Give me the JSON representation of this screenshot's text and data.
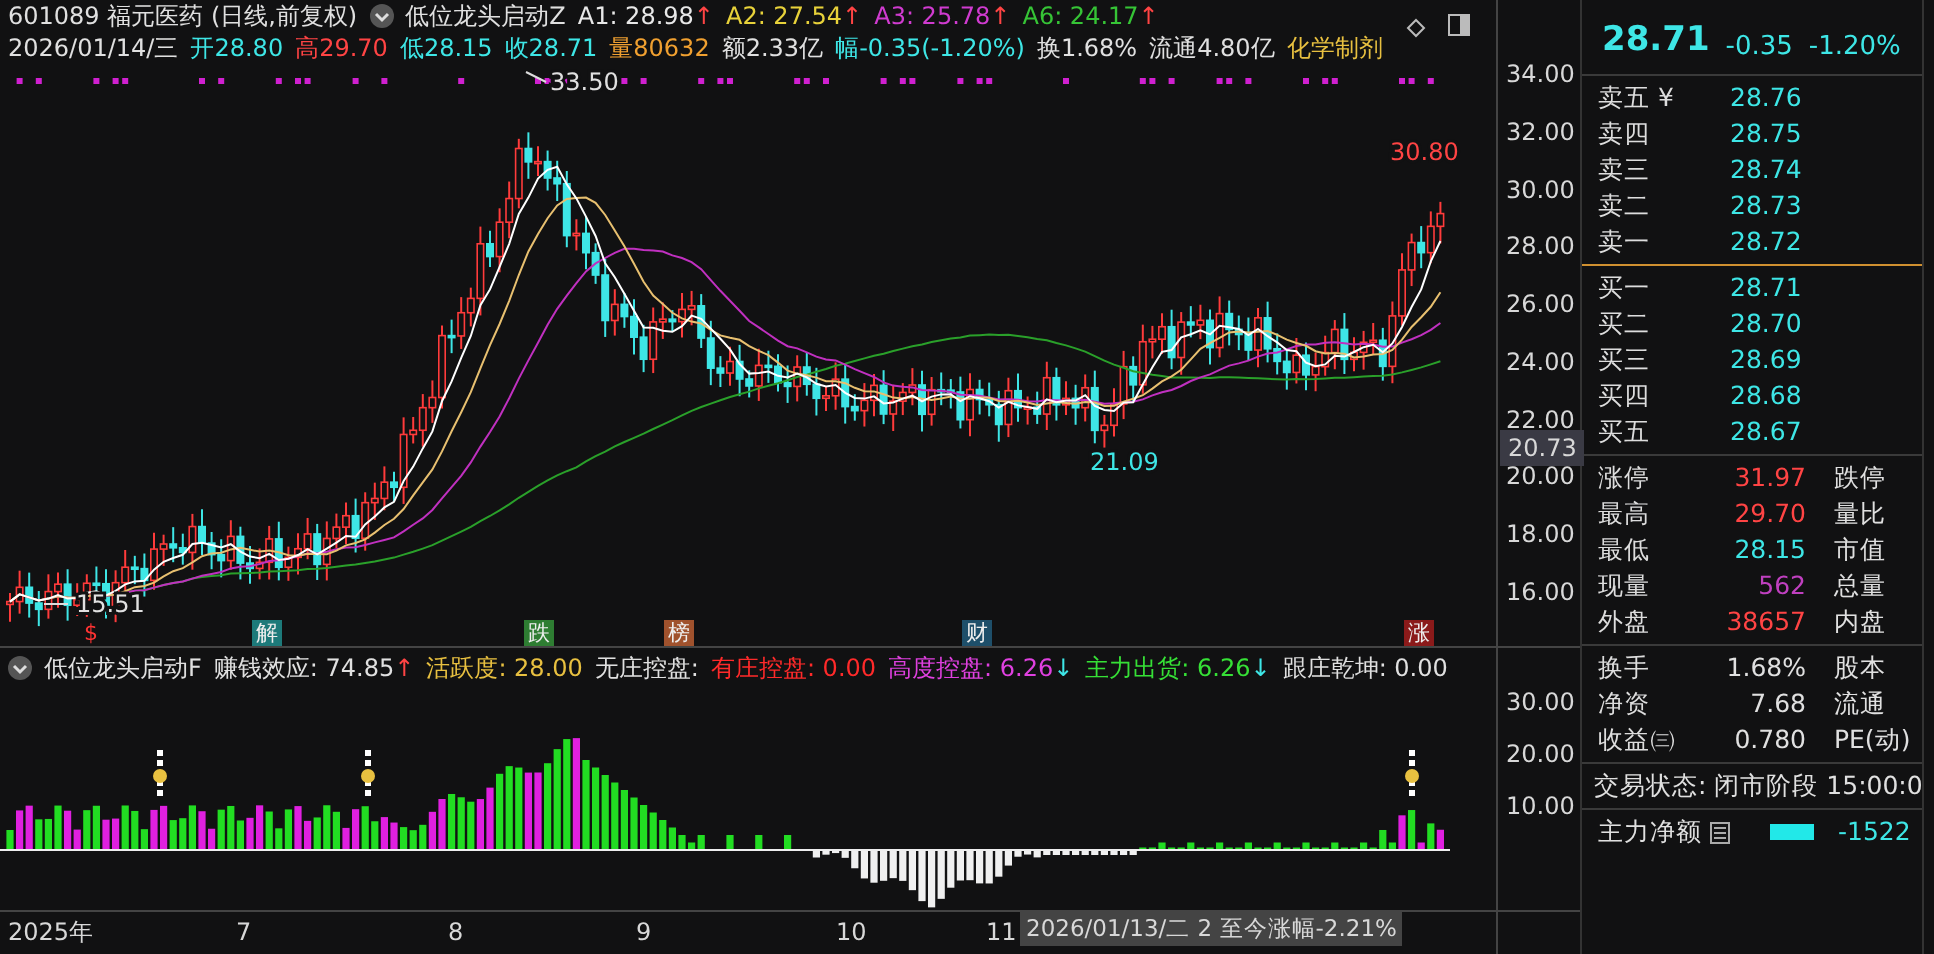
{
  "title_line": {
    "code": "601089 福元医药 (日线,前复权)",
    "indicator": "低位龙头启动Z",
    "values": [
      {
        "text": "A1: 28.98",
        "color": "#e8e8e8",
        "arrow": "↑"
      },
      {
        "text": "A2: 27.54",
        "color": "#e8d23a",
        "arrow": "↑"
      },
      {
        "text": "A3: 25.78",
        "color": "#d03bd0",
        "arrow": "↑"
      },
      {
        "text": "A6: 24.17",
        "color": "#36c436",
        "arrow": "↑"
      }
    ]
  },
  "quote_line": [
    {
      "text": "2026/01/14/三",
      "color": "#e0e0e0"
    },
    {
      "text": "开28.80",
      "color": "#3ee6e6"
    },
    {
      "text": "高29.70",
      "color": "#ff4444"
    },
    {
      "text": "低28.15",
      "color": "#3ee6e6"
    },
    {
      "text": "收28.71",
      "color": "#3ee6e6"
    },
    {
      "text": "量80632",
      "color": "#f0a030"
    },
    {
      "text": "额2.33亿",
      "color": "#e0e0e0"
    },
    {
      "text": "幅-0.35(-1.20%)",
      "color": "#3ee6e6"
    },
    {
      "text": "换1.68%",
      "color": "#e0e0e0"
    },
    {
      "text": "流通4.80亿",
      "color": "#e0e0e0"
    },
    {
      "text": "化学制剂",
      "color": "#e8c040"
    }
  ],
  "price_chart": {
    "axis": [
      "34.00",
      "32.00",
      "30.00",
      "28.00",
      "26.00",
      "24.00",
      "22.00",
      "20.00",
      "18.00",
      "16.00"
    ],
    "axis_marker": "20.73",
    "labels": [
      {
        "text": "33.50",
        "color": "#e0e0e0"
      },
      {
        "text": "15.51",
        "color": "#e0e0e0"
      },
      {
        "text": "21.09",
        "color": "#3ee6e6"
      },
      {
        "text": "30.80",
        "color": "#ff4444"
      }
    ],
    "event_tags": [
      {
        "text": "$",
        "color": "#ff3333"
      },
      {
        "text": "解",
        "color": "#1d7a7a"
      },
      {
        "text": "跌",
        "color": "#2e7d32"
      },
      {
        "text": "榜",
        "color": "#a0522d"
      },
      {
        "text": "财",
        "color": "#1e4f6a"
      },
      {
        "text": "涨",
        "color": "#8b1a1a"
      }
    ]
  },
  "indicator_panel": {
    "name": "低位龙头启动F",
    "values": [
      {
        "text": "赚钱效应: 74.85",
        "color": "#e0e0e0",
        "arrow": {
          "text": "↑",
          "color": "#ff4444"
        }
      },
      {
        "text": "活跃度: 28.00",
        "color": "#e8c040"
      },
      {
        "text": "无庄控盘:",
        "color": "#e0e0e0"
      },
      {
        "text": "有庄控盘: 0.00",
        "color": "#ff2a2a"
      },
      {
        "text": "高度控盘: 6.26",
        "color": "#e040e0",
        "arrow": {
          "text": "↓",
          "color": "#3ee6e6"
        }
      },
      {
        "text": "主力出货: 6.26",
        "color": "#36e036",
        "arrow": {
          "text": "↓",
          "color": "#3ee6e6"
        }
      },
      {
        "text": "跟庄乾坤: 0.00",
        "color": "#e0e0e0"
      }
    ],
    "axis": [
      "30.00",
      "20.00",
      "10.00"
    ]
  },
  "date_axis": {
    "labels": [
      "2025年",
      "7",
      "8",
      "9",
      "10",
      "11"
    ],
    "cursor_info": "2026/01/13/二 2 至今涨幅-2.21%"
  },
  "side_panel": {
    "quote": {
      "price": "28.71",
      "change": "-0.35",
      "percent": "-1.20%"
    },
    "asks": [
      {
        "label": "卖五 ¥",
        "price": "28.76"
      },
      {
        "label": "卖四",
        "price": "28.75"
      },
      {
        "label": "卖三",
        "price": "28.74"
      },
      {
        "label": "卖二",
        "price": "28.73"
      },
      {
        "label": "卖一",
        "price": "28.72"
      }
    ],
    "bids": [
      {
        "label": "买一",
        "price": "28.71"
      },
      {
        "label": "买二",
        "price": "28.70"
      },
      {
        "label": "买三",
        "price": "28.69"
      },
      {
        "label": "买四",
        "price": "28.68"
      },
      {
        "label": "买五",
        "price": "28.67"
      }
    ],
    "stats": [
      {
        "label": "涨停",
        "value": "31.97",
        "color": "#ff4444",
        "label2": "跌停"
      },
      {
        "label": "最高",
        "value": "29.70",
        "color": "#ff4444",
        "label2": "量比"
      },
      {
        "label": "最低",
        "value": "28.15",
        "color": "#3ee6e6",
        "label2": "市值"
      },
      {
        "label": "现量",
        "value": "562",
        "color": "#c040c0",
        "label2": "总量"
      },
      {
        "label": "外盘",
        "value": "38657",
        "color": "#ff4444",
        "label2": "内盘"
      }
    ],
    "fundamentals": [
      {
        "label": "换手",
        "value": "1.68%",
        "label2": "股本"
      },
      {
        "label": "净资",
        "value": "7.68",
        "label2": "流通"
      },
      {
        "label": "收益㈢",
        "value": "0.780",
        "label2": "PE(动)"
      }
    ],
    "status": "交易状态: 闭市阶段 15:00:0",
    "net_flow": {
      "label": "主力净额",
      "value": "-1522"
    }
  }
}
